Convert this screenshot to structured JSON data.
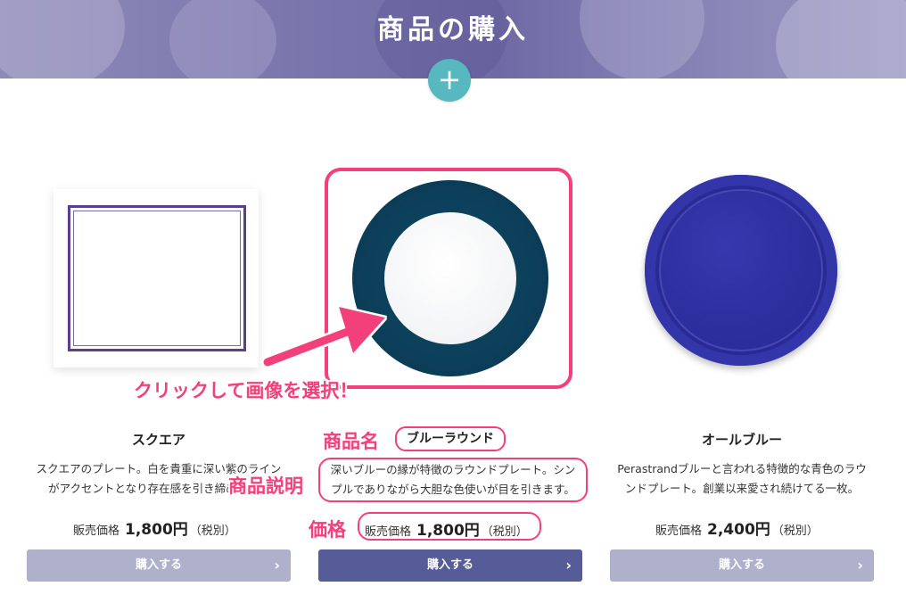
{
  "header": {
    "title": "商品の購入",
    "add_icon": "plus-icon"
  },
  "annotations": {
    "click_hint": "クリックして画像を選択！",
    "name_label": "商品名",
    "description_label": "商品説明",
    "price_label": "価格",
    "highlight_color": "#f43f7a"
  },
  "products": [
    {
      "name": "スクエア",
      "image": "square-plate-image",
      "description_line1": "スクエアのプレート。白を貴重に深い紫のライン",
      "description_line2": "がアクセントとなり存在感を引き締めます。",
      "price_prefix": "販売価格",
      "price": "1,800円",
      "tax_note": "（税別）",
      "buy_label": "購入する",
      "button_color": "#aeb0cc"
    },
    {
      "name": "ブルーラウンド",
      "image": "blue-round-plate-image",
      "description_line1": "深いブルーの縁が特徴のラウンドプレート。シン",
      "description_line2": "プルでありながら大胆な色使いが目を引きます。",
      "price_prefix": "販売価格",
      "price": "1,800円",
      "tax_note": "（税別）",
      "buy_label": "購入する",
      "button_color": "#565c97"
    },
    {
      "name": "オールブルー",
      "image": "all-blue-plate-image",
      "description_line1": "Perastrandブルーと言われる特徴的な青色のラウ",
      "description_line2": "ンドプレート。創業以来愛され続けてる一枚。",
      "price_prefix": "販売価格",
      "price": "2,400円",
      "tax_note": "（税別）",
      "buy_label": "購入する",
      "button_color": "#aeb0cc"
    }
  ]
}
